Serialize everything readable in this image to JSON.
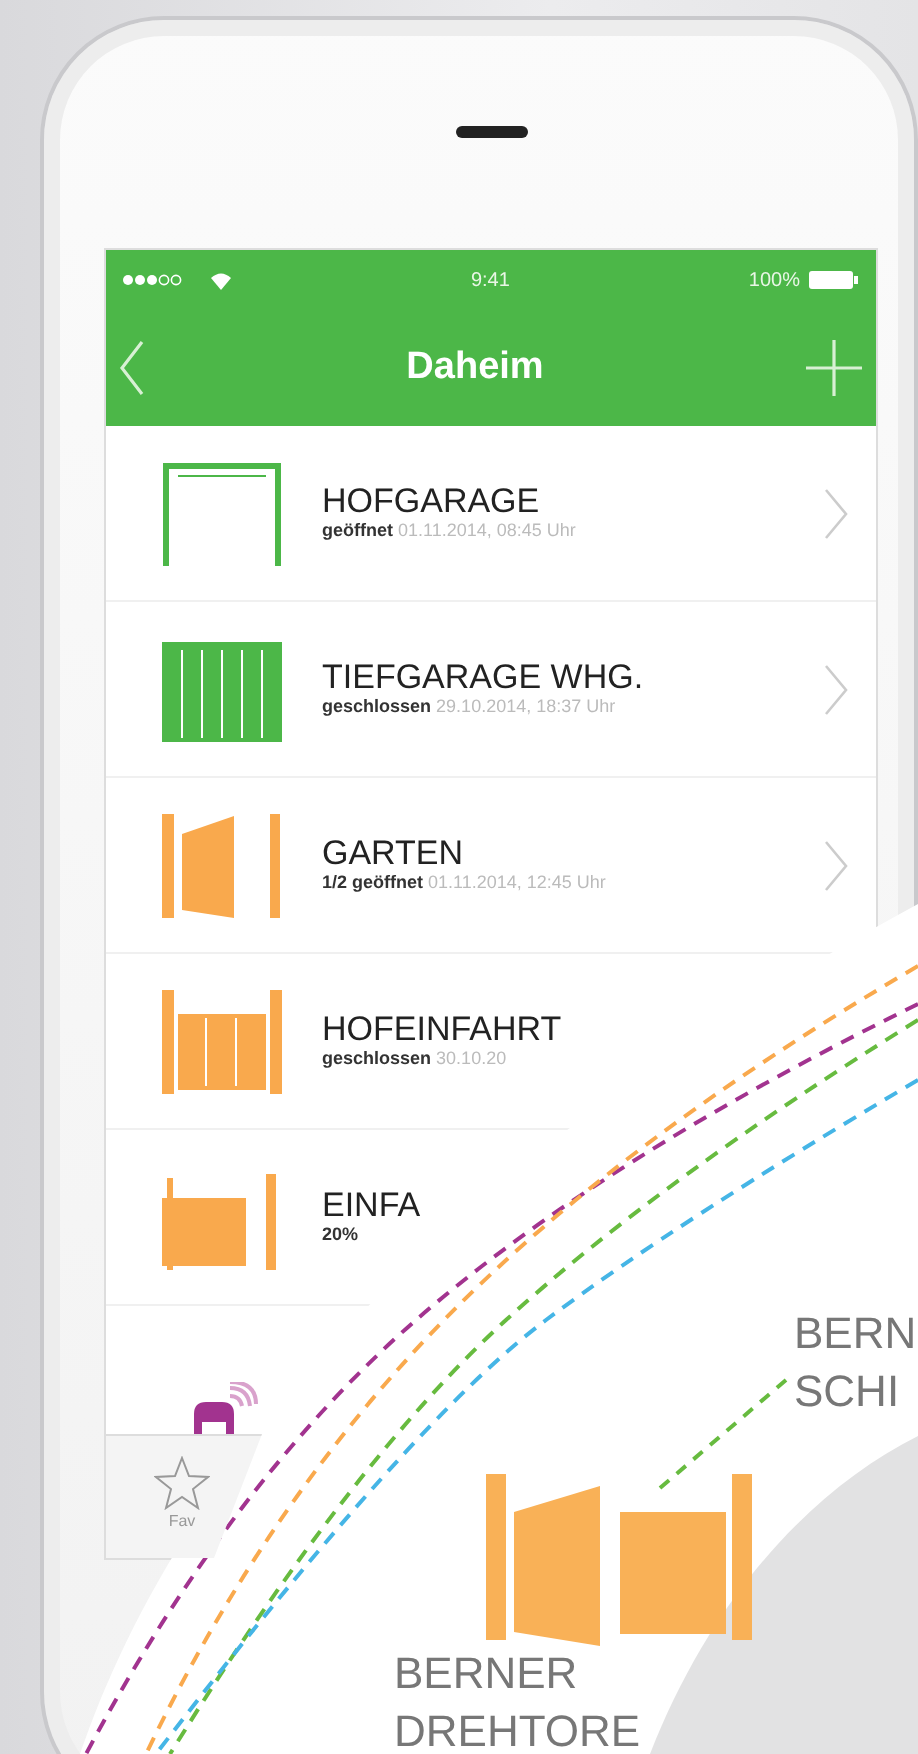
{
  "status_bar": {
    "time": "9:41",
    "battery": "100%"
  },
  "nav": {
    "title": "Daheim"
  },
  "gates": [
    {
      "name": "HOFGARAGE",
      "state": "geöffnet",
      "timestamp": "01.11.2014, 08:45 Uhr",
      "kind": "garage_open",
      "color": "#4cb748",
      "chevron": true
    },
    {
      "name": "TIEFGARAGE WHG.",
      "state": "geschlossen",
      "timestamp": "29.10.2014, 18:37 Uhr",
      "kind": "garage_closed",
      "color": "#4cb748",
      "chevron": true
    },
    {
      "name": "GARTEN",
      "state": "1/2 geöffnet",
      "timestamp": "01.11.2014, 12:45 Uhr",
      "kind": "swing_half_open",
      "color": "#f9a94d",
      "chevron": true
    },
    {
      "name": "HOFEINFAHRT",
      "state": "geschlossen",
      "timestamp": "30.10.20",
      "kind": "swing_closed",
      "color": "#f9a94d"
    },
    {
      "name": "EINFA",
      "state": "20%",
      "kind": "sliding",
      "color": "#f9a94d"
    }
  ],
  "partial_item": {
    "kind": "remote"
  },
  "tab_bar": [
    {
      "label": "Fav"
    }
  ],
  "overlay": {
    "arcs": [
      {
        "color": "#a2338f"
      },
      {
        "color": "#f9a94d"
      },
      {
        "color": "#67bb3f"
      },
      {
        "color": "#45b5e6"
      }
    ],
    "labels": [
      {
        "lines": [
          "BERNER",
          "DREHTORE"
        ]
      },
      {
        "lines": [
          "BERN",
          "SCHI"
        ]
      }
    ]
  }
}
